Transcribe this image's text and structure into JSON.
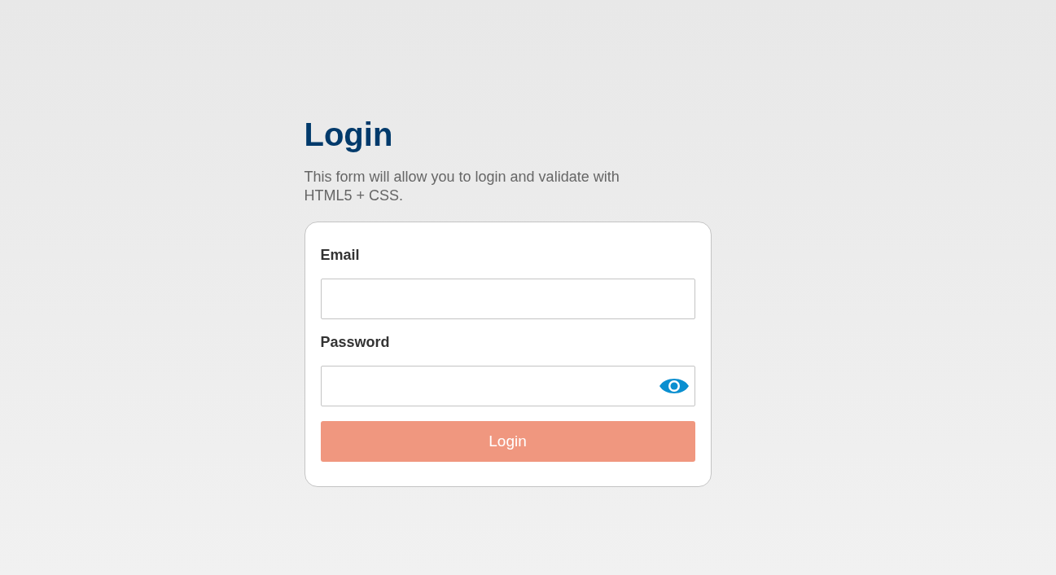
{
  "title": "Login",
  "subtitle": "This form will allow you to login and validate with HTML5 + CSS.",
  "fields": [
    {
      "label": "Email",
      "reveal_icon": false
    },
    {
      "label": "Password",
      "reveal_icon": true
    }
  ],
  "button": {
    "label": "Login",
    "disabled": true
  }
}
